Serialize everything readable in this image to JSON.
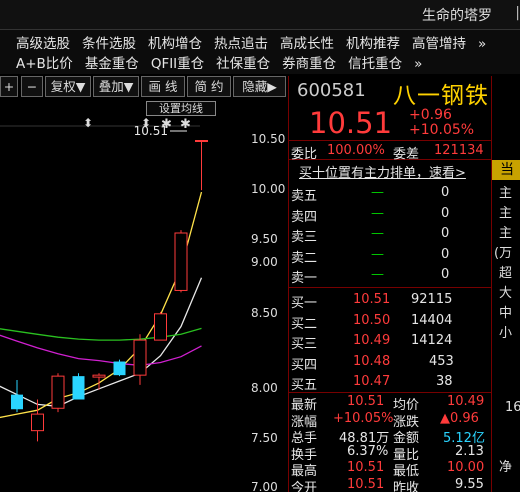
{
  "app": {
    "title": "生命的塔罗",
    "window_glyph": "|"
  },
  "menu": {
    "row1": [
      "高级选股",
      "条件选股",
      "机构增仓",
      "热点追击",
      "高成长性",
      "机构推荐",
      "高管增持",
      "»"
    ],
    "row2": [
      "A+B比价",
      "基金重仓",
      "QFII重仓",
      "社保重仓",
      "券商重仓",
      "信托重仓",
      "»"
    ]
  },
  "toolbar": {
    "plus": "+",
    "minus": "−",
    "rights": "复权▼",
    "overlay": "叠加▼",
    "draw": "画 线",
    "simple": "简 约",
    "hide": "隐藏▶"
  },
  "chart": {
    "ma_settings_label": "设置均线",
    "last_price_label": "10.51",
    "marker_arrow": "⬍",
    "marker_star": "✱",
    "y_ticks": [
      "10.50",
      "10.00",
      "9.50",
      "9.00",
      "8.50",
      "8.00",
      "7.50",
      "7.00"
    ],
    "colors": {
      "up": "#ff3b3b",
      "down": "#2ad4ff",
      "ma_white": "#e8e8e8",
      "ma_yellow": "#ffe24a",
      "ma_magenta": "#d020d0",
      "ma_green": "#2ac020"
    }
  },
  "chart_data": {
    "type": "candlestick",
    "y_range": [
      6.9,
      10.7
    ],
    "candles": [
      {
        "open": 7.9,
        "high": 8.05,
        "low": 7.72,
        "close": 7.75
      },
      {
        "open": 7.53,
        "high": 7.85,
        "low": 7.42,
        "close": 7.7
      },
      {
        "open": 7.76,
        "high": 8.12,
        "low": 7.72,
        "close": 8.09
      },
      {
        "open": 8.09,
        "high": 8.12,
        "low": 7.85,
        "close": 7.85
      },
      {
        "open": 8.08,
        "high": 8.12,
        "low": 7.95,
        "close": 8.1
      },
      {
        "open": 8.24,
        "high": 8.26,
        "low": 8.09,
        "close": 8.1
      },
      {
        "open": 8.1,
        "high": 8.52,
        "low": 8.0,
        "close": 8.46
      },
      {
        "open": 8.46,
        "high": 8.75,
        "low": 8.46,
        "close": 8.73
      },
      {
        "open": 8.97,
        "high": 9.59,
        "low": 8.95,
        "close": 9.56
      },
      {
        "open": 10.51,
        "high": 10.51,
        "low": 10.0,
        "close": 10.51
      }
    ],
    "series": [
      {
        "name": "MA-white",
        "values": [
          7.9,
          7.8,
          7.78,
          7.88,
          7.96,
          8.04,
          8.12,
          8.3,
          8.6,
          9.1
        ]
      },
      {
        "name": "MA-yellow",
        "values": [
          7.7,
          7.74,
          7.86,
          7.92,
          8.02,
          8.16,
          8.38,
          8.72,
          9.2,
          9.98
        ]
      },
      {
        "name": "MA-magenta",
        "values": [
          8.45,
          8.38,
          8.32,
          8.27,
          8.25,
          8.22,
          8.2,
          8.23,
          8.29,
          8.4
        ]
      },
      {
        "name": "MA-green",
        "values": [
          8.55,
          8.52,
          8.49,
          8.47,
          8.46,
          8.46,
          8.47,
          8.49,
          8.52,
          8.58
        ]
      }
    ]
  },
  "quote": {
    "code": "600581",
    "name": "八一钢铁",
    "price": "10.51",
    "change": "+0.96",
    "change_pct": "+10.05%",
    "weibi_label": "委比",
    "weibi_value": "100.00%",
    "weicha_label": "委差",
    "weicha_value": "121134",
    "ad_text": "买十位置有主力排单，速看>",
    "sell": [
      {
        "label": "卖五",
        "price": "—",
        "vol": "0"
      },
      {
        "label": "卖四",
        "price": "—",
        "vol": "0"
      },
      {
        "label": "卖三",
        "price": "—",
        "vol": "0"
      },
      {
        "label": "卖二",
        "price": "—",
        "vol": "0"
      },
      {
        "label": "卖一",
        "price": "—",
        "vol": "0"
      }
    ],
    "buy": [
      {
        "label": "买一",
        "price": "10.51",
        "vol": "92115"
      },
      {
        "label": "买二",
        "price": "10.50",
        "vol": "14404"
      },
      {
        "label": "买三",
        "price": "10.49",
        "vol": "14124"
      },
      {
        "label": "买四",
        "price": "10.48",
        "vol": "453"
      },
      {
        "label": "买五",
        "price": "10.47",
        "vol": "38"
      }
    ],
    "stats": [
      {
        "k1": "最新",
        "v1": "10.51",
        "k2": "均价",
        "v2": "10.49"
      },
      {
        "k1": "涨幅",
        "v1": "+10.05%",
        "k2": "涨跌",
        "v2": "▲0.96"
      },
      {
        "k1": "总手",
        "v1": "48.81万",
        "k2": "金额",
        "v2": "5.12亿"
      },
      {
        "k1": "换手",
        "v1": "6.37%",
        "k2": "量比",
        "v2": "2.13"
      },
      {
        "k1": "最高",
        "v1": "10.51",
        "k2": "最低",
        "v2": "10.00"
      },
      {
        "k1": "今开",
        "v1": "10.51",
        "k2": "昨收",
        "v2": "9.55"
      }
    ]
  },
  "side": {
    "tag": "当",
    "labels": [
      "主",
      "主",
      "主",
      "(万",
      "超",
      "大",
      "中",
      "小"
    ],
    "bottom_value": "16",
    "bottom_label": "净"
  }
}
